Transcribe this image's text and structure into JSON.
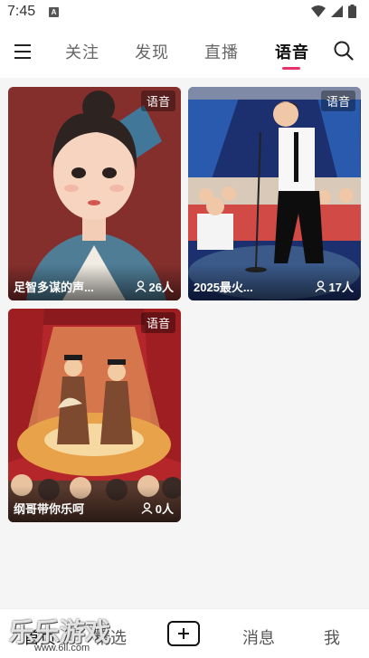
{
  "status_bar": {
    "time": "7:45",
    "notification_icon": "A"
  },
  "top_nav": {
    "tabs": [
      {
        "label": "关注"
      },
      {
        "label": "发现"
      },
      {
        "label": "直播"
      },
      {
        "label": "语音",
        "active": true
      }
    ]
  },
  "cards": [
    {
      "badge": "语音",
      "title": "足智多谋的声...",
      "count": "26人"
    },
    {
      "badge": "语音",
      "title": "2025最火...",
      "count": "17人"
    },
    {
      "badge": "语音",
      "title": "纲哥带你乐呵",
      "count": "0人"
    }
  ],
  "bottom_nav": {
    "home_label": "首页",
    "featured_label": "精选",
    "messages_label": "消息",
    "me_label": "我"
  },
  "watermark": {
    "text": "乐乐游戏",
    "url": "www.6ll.com"
  },
  "colors": {
    "accent": "#e8336a"
  }
}
